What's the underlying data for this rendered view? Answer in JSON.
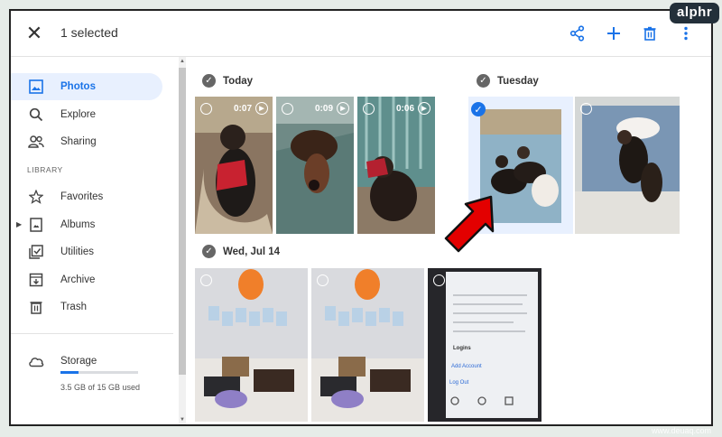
{
  "brand": "alphr",
  "header": {
    "selected_text": "1 selected",
    "icons": [
      "close-icon",
      "share-icon",
      "add-icon",
      "trash-icon",
      "more-vert-icon"
    ]
  },
  "sidebar": {
    "items": [
      {
        "label": "Photos",
        "icon": "photos-icon",
        "active": true
      },
      {
        "label": "Explore",
        "icon": "search-icon"
      },
      {
        "label": "Sharing",
        "icon": "people-icon"
      }
    ],
    "library_label": "LIBRARY",
    "library_items": [
      {
        "label": "Favorites",
        "icon": "star-icon"
      },
      {
        "label": "Albums",
        "icon": "album-icon"
      },
      {
        "label": "Utilities",
        "icon": "utilities-icon"
      },
      {
        "label": "Archive",
        "icon": "archive-icon"
      },
      {
        "label": "Trash",
        "icon": "trash-icon"
      }
    ],
    "storage": {
      "label": "Storage",
      "usage_text": "3.5 GB of 15 GB used",
      "used_fraction": 0.233
    }
  },
  "groups": [
    {
      "date": "Today",
      "videos": [
        "0:07",
        "0:09",
        "0:06"
      ]
    },
    {
      "date": "Tuesday"
    },
    {
      "date": "Wed, Jul 14"
    }
  ],
  "phone_screen": {
    "texts": [
      "Logins",
      "Add Account",
      "Log Out"
    ]
  },
  "watermark": "www.deuaq.com",
  "colors": {
    "accent": "#1a73e8",
    "selected_bg": "#e8f0fe",
    "arrow": "#e30000"
  }
}
